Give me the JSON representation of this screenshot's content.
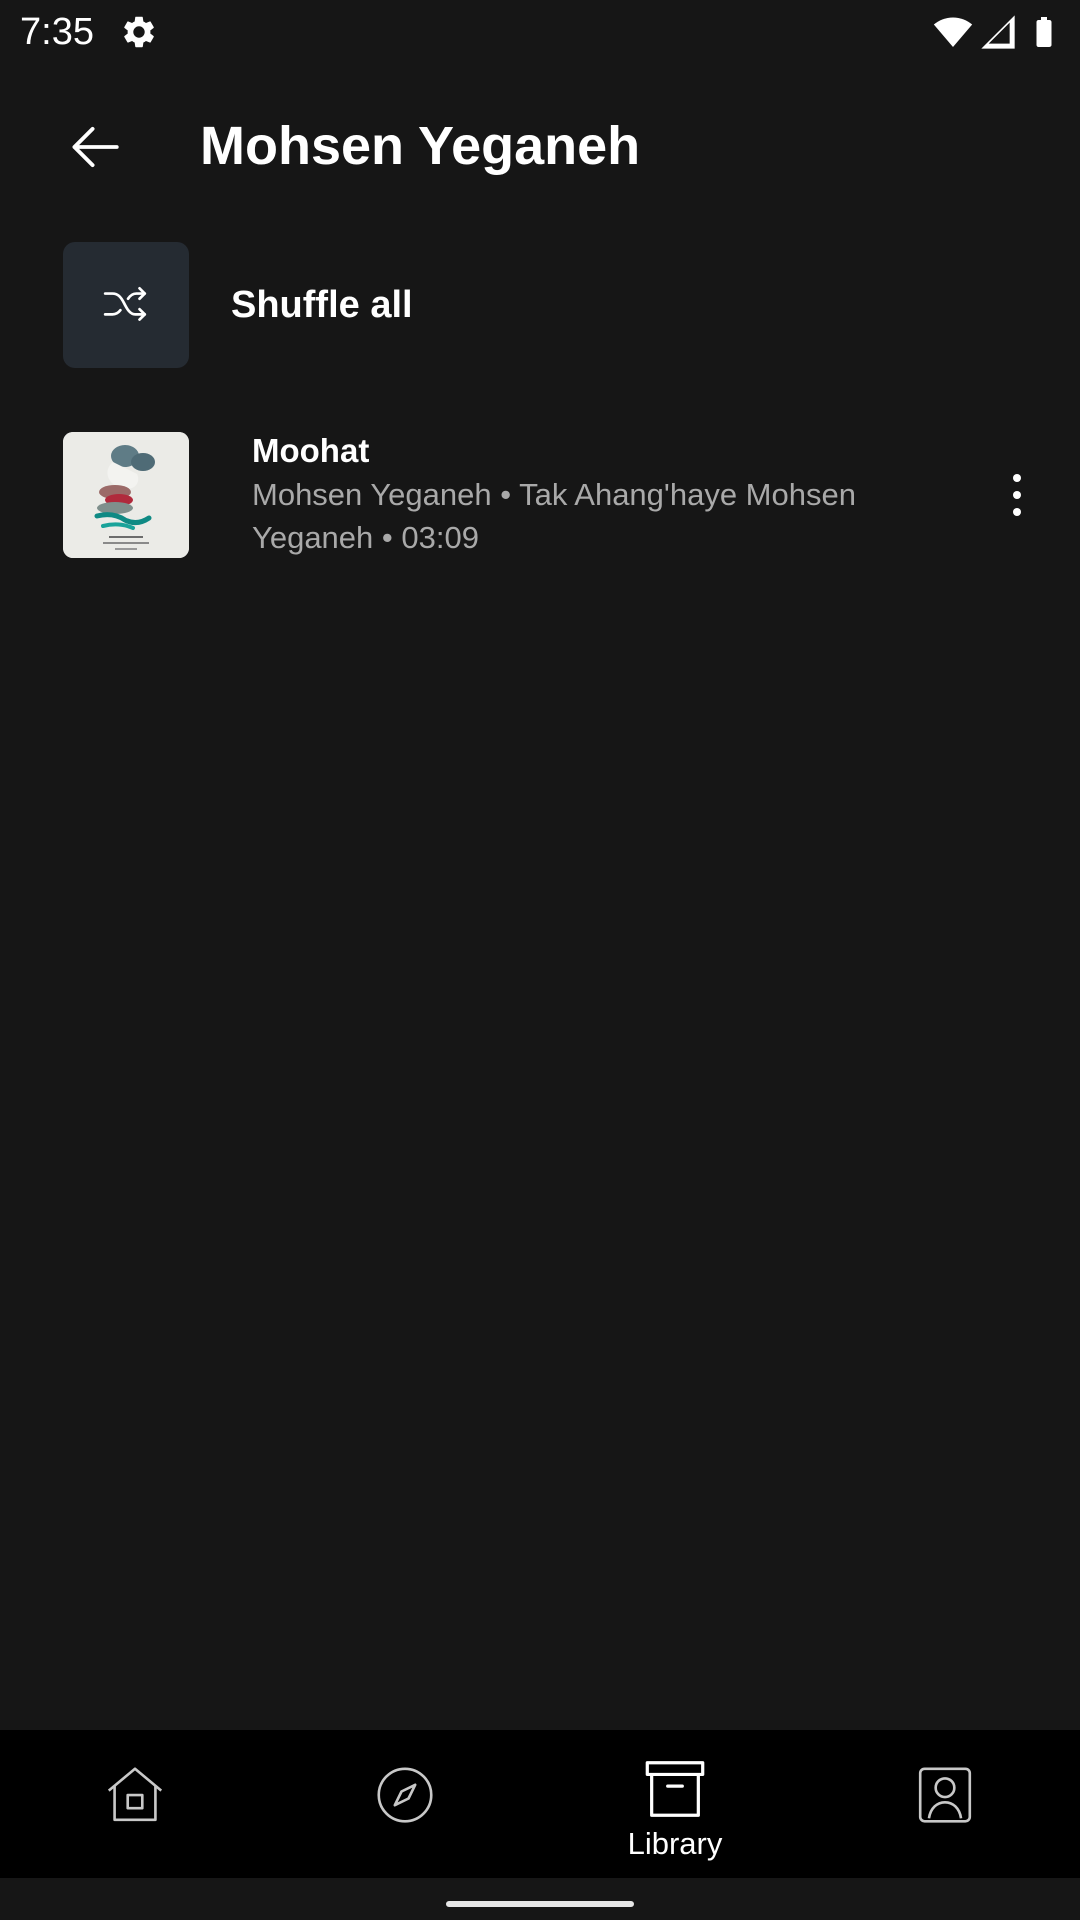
{
  "status_bar": {
    "time": "7:35",
    "icons": [
      "settings-icon",
      "wifi-icon",
      "signal-icon",
      "battery-icon"
    ]
  },
  "header": {
    "title": "Mohsen Yeganeh",
    "back_icon": "arrow-back-icon"
  },
  "shuffle": {
    "label": "Shuffle all",
    "icon": "shuffle-icon"
  },
  "songs": [
    {
      "title": "Moohat",
      "subtitle": "Mohsen Yeganeh • Tak Ahang'haye Mohsen Yeganeh • 03:09",
      "menu_icon": "more-vert-icon"
    }
  ],
  "bottom_nav": {
    "items": [
      {
        "icon": "home-icon",
        "label": ""
      },
      {
        "icon": "explore-icon",
        "label": ""
      },
      {
        "icon": "library-icon",
        "label": "Library",
        "active": true
      },
      {
        "icon": "account-icon",
        "label": ""
      }
    ]
  },
  "colors": {
    "background": "#161616",
    "nav_background": "#000000",
    "shuffle_tile": "#252b32",
    "secondary_text": "#a9a9a9"
  }
}
